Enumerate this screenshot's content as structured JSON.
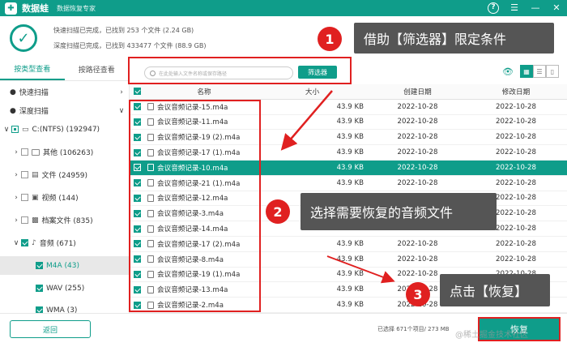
{
  "titlebar": {
    "logo": "✚",
    "app_name": "数据蛙",
    "subtitle": "数据恢复专家",
    "controls": [
      "?",
      "☰",
      "—",
      "✕"
    ]
  },
  "status": {
    "line1": "快速扫描已完成，已找到 253 个文件 (2.24 GB)",
    "line2": "深度扫描已完成，已找到 433477 个文件 (88.9 GB)"
  },
  "callouts": [
    {
      "number": "1",
      "text": "借助【筛选器】限定条件"
    },
    {
      "number": "2",
      "text": "选择需要恢复的音频文件"
    },
    {
      "number": "3",
      "text": "点击【恢复】"
    }
  ],
  "sidebar": {
    "tabs": [
      "按类型查看",
      "按路径查看"
    ],
    "items": [
      {
        "label": "快速扫描",
        "expander": "›"
      },
      {
        "label": "深度扫描",
        "expander": "∨"
      },
      {
        "label": "C:(NTFS) (192947)",
        "expander": "∨"
      },
      {
        "label": "其他 (106263)",
        "expander": "›"
      },
      {
        "label": "文件 (24959)",
        "expander": "›"
      },
      {
        "label": "视频 (144)",
        "expander": "›"
      },
      {
        "label": "档案文件 (835)",
        "expander": "›"
      },
      {
        "label": "音频 (671)",
        "expander": "∨"
      },
      {
        "label": "M4A (43)",
        "expander": ""
      },
      {
        "label": "WAV (255)",
        "expander": ""
      },
      {
        "label": "WMA (3)",
        "expander": ""
      }
    ]
  },
  "toolbar": {
    "search_placeholder": "在此处输入文件名称或保存路径",
    "filter_label": "筛选器",
    "eye": "👁",
    "view_icons": [
      "▦",
      "☰",
      "▯"
    ]
  },
  "table": {
    "headers": [
      "名称",
      "大小",
      "创建日期",
      "修改日期"
    ],
    "rows": [
      {
        "name": "会议音频记录-15.m4a",
        "size": "43.9 KB",
        "created": "2022-10-28",
        "modified": "2022-10-28"
      },
      {
        "name": "会议音频记录-11.m4a",
        "size": "43.9 KB",
        "created": "2022-10-28",
        "modified": "2022-10-28"
      },
      {
        "name": "会议音频记录-19 (2).m4a",
        "size": "43.9 KB",
        "created": "2022-10-28",
        "modified": "2022-10-28"
      },
      {
        "name": "会议音频记录-17 (1).m4a",
        "size": "43.9 KB",
        "created": "2022-10-28",
        "modified": "2022-10-28"
      },
      {
        "name": "会议音频记录-10.m4a",
        "size": "43.9 KB",
        "created": "2022-10-28",
        "modified": "2022-10-28"
      },
      {
        "name": "会议音频记录-21 (1).m4a",
        "size": "43.9 KB",
        "created": "2022-10-28",
        "modified": "2022-10-28"
      },
      {
        "name": "会议音频记录-12.m4a",
        "size": "43.9 KB",
        "created": "2022-10-28",
        "modified": "2022-10-28"
      },
      {
        "name": "会议音频记录-3.m4a",
        "size": "43.9 KB",
        "created": "2022-10-28",
        "modified": "2022-10-28"
      },
      {
        "name": "会议音频记录-14.m4a",
        "size": "43.9 KB",
        "created": "2022-10-28",
        "modified": "2022-10-28"
      },
      {
        "name": "会议音频记录-17 (2).m4a",
        "size": "43.9 KB",
        "created": "2022-10-28",
        "modified": "2022-10-28"
      },
      {
        "name": "会议音频记录-8.m4a",
        "size": "43.9 KB",
        "created": "2022-10-28",
        "modified": "2022-10-28"
      },
      {
        "name": "会议音频记录-19 (1).m4a",
        "size": "43.9 KB",
        "created": "2022-10-28",
        "modified": "2022-10-28"
      },
      {
        "name": "会议音频记录-13.m4a",
        "size": "43.9 KB",
        "created": "2022-10-28",
        "modified": "2022-10-28"
      },
      {
        "name": "会议音频记录-2.m4a",
        "size": "43.9 KB",
        "created": "2022-10-28",
        "modified": "2022-10-28"
      }
    ]
  },
  "bottom": {
    "back_label": "返回",
    "selection_info": "已选择 671个项目/ 273 MB",
    "recover_label": "恢复",
    "watermark": "@稀土掘金技术社区"
  },
  "colors": {
    "accent": "#0f9d8a",
    "annotation": "#e02020",
    "callout_bg": "#555555"
  }
}
